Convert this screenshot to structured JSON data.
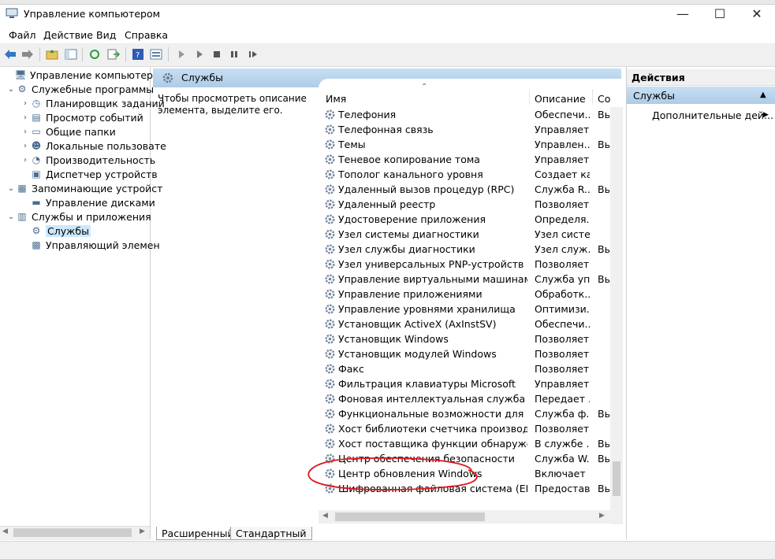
{
  "window": {
    "title": "Управление компьютером",
    "minimize": "—",
    "maximize": "☐",
    "close": "✕"
  },
  "menu": [
    "Файл",
    "Действие",
    "Вид",
    "Справка"
  ],
  "tree": [
    {
      "label": "Управление компьютером (л",
      "icon": "computer-icon",
      "level": 0,
      "arrow": ""
    },
    {
      "label": "Служебные программы",
      "icon": "tools-icon",
      "level": 1,
      "arrow": "⌄"
    },
    {
      "label": "Планировщик заданий",
      "icon": "clock-icon",
      "level": 2,
      "arrow": "›"
    },
    {
      "label": "Просмотр событий",
      "icon": "event-viewer-icon",
      "level": 2,
      "arrow": "›"
    },
    {
      "label": "Общие папки",
      "icon": "folder-icon",
      "level": 2,
      "arrow": "›"
    },
    {
      "label": "Локальные пользовате",
      "icon": "users-icon",
      "level": 2,
      "arrow": "›"
    },
    {
      "label": "Производительность",
      "icon": "performance-icon",
      "level": 2,
      "arrow": "›"
    },
    {
      "label": "Диспетчер устройств",
      "icon": "device-manager-icon",
      "level": 2,
      "arrow": ""
    },
    {
      "label": "Запоминающие устройст",
      "icon": "storage-icon",
      "level": 1,
      "arrow": "⌄"
    },
    {
      "label": "Управление дисками",
      "icon": "disk-icon",
      "level": 2,
      "arrow": ""
    },
    {
      "label": "Службы и приложения",
      "icon": "services-apps-icon",
      "level": 1,
      "arrow": "⌄"
    },
    {
      "label": "Службы",
      "icon": "gear-icon",
      "level": 2,
      "arrow": "",
      "selected": true
    },
    {
      "label": "Управляющий элемен",
      "icon": "wmi-icon",
      "level": 2,
      "arrow": ""
    }
  ],
  "center": {
    "header": "Службы",
    "description": "Чтобы просмотреть описание элемента, выделите его.",
    "columns": [
      "Имя",
      "Описание",
      "Со"
    ],
    "sort_arrow": "⌃",
    "rows": [
      {
        "name": "Телефония",
        "desc": "Обеспечи...",
        "state": "Вы"
      },
      {
        "name": "Телефонная связь",
        "desc": "Управляет...",
        "state": ""
      },
      {
        "name": "Темы",
        "desc": "Управлен...",
        "state": "Вы"
      },
      {
        "name": "Теневое копирование тома",
        "desc": "Управляет...",
        "state": ""
      },
      {
        "name": "Тополог канального уровня",
        "desc": "Создает ка...",
        "state": ""
      },
      {
        "name": "Удаленный вызов процедур (RPC)",
        "desc": "Служба R...",
        "state": "Вы"
      },
      {
        "name": "Удаленный реестр",
        "desc": "Позволяет...",
        "state": ""
      },
      {
        "name": "Удостоверение приложения",
        "desc": "Определя...",
        "state": ""
      },
      {
        "name": "Узел системы диагностики",
        "desc": "Узел систе...",
        "state": ""
      },
      {
        "name": "Узел службы диагностики",
        "desc": "Узел служ...",
        "state": "Вы"
      },
      {
        "name": "Узел универсальных PNP-устройств",
        "desc": "Позволяет...",
        "state": ""
      },
      {
        "name": "Управление виртуальными машинами Н...",
        "desc": "Служба уп...",
        "state": "Вы"
      },
      {
        "name": "Управление приложениями",
        "desc": "Обработк...",
        "state": ""
      },
      {
        "name": "Управление уровнями хранилища",
        "desc": "Оптимизи...",
        "state": ""
      },
      {
        "name": "Установщик ActiveX (AxInstSV)",
        "desc": "Обеспечи...",
        "state": ""
      },
      {
        "name": "Установщик Windows",
        "desc": "Позволяет...",
        "state": ""
      },
      {
        "name": "Установщик модулей Windows",
        "desc": "Позволяет...",
        "state": ""
      },
      {
        "name": "Факс",
        "desc": "Позволяет...",
        "state": ""
      },
      {
        "name": "Фильтрация клавиатуры Microsoft",
        "desc": "Управляет...",
        "state": ""
      },
      {
        "name": "Фоновая интеллектуальная служба перед...",
        "desc": "Передает ...",
        "state": ""
      },
      {
        "name": "Функциональные возможности для подк...",
        "desc": "Служба ф...",
        "state": "Вы"
      },
      {
        "name": "Хост библиотеки счетчика производител...",
        "desc": "Позволяет...",
        "state": ""
      },
      {
        "name": "Хост поставщика функции обнаружения",
        "desc": "В службе ...",
        "state": "Вы"
      },
      {
        "name": "Центр обеспечения безопасности",
        "desc": "Служба W...",
        "state": "Вы"
      },
      {
        "name": "Центр обновления Windows",
        "desc": "Включает ...",
        "state": ""
      },
      {
        "name": "Шифрованная файловая система (EFS)",
        "desc": "Предостав...",
        "state": "Вы"
      }
    ],
    "tabs": [
      "Расширенный",
      "Стандартный"
    ]
  },
  "actions": {
    "title": "Действия",
    "section": "Службы",
    "more": "Дополнительные дей...",
    "more_arrow": "▶",
    "collapse_arrow": "▲"
  },
  "colors": {
    "header_blue": "#aecbe6",
    "selection": "#cce8ff",
    "annotation_red": "#e0151b"
  }
}
